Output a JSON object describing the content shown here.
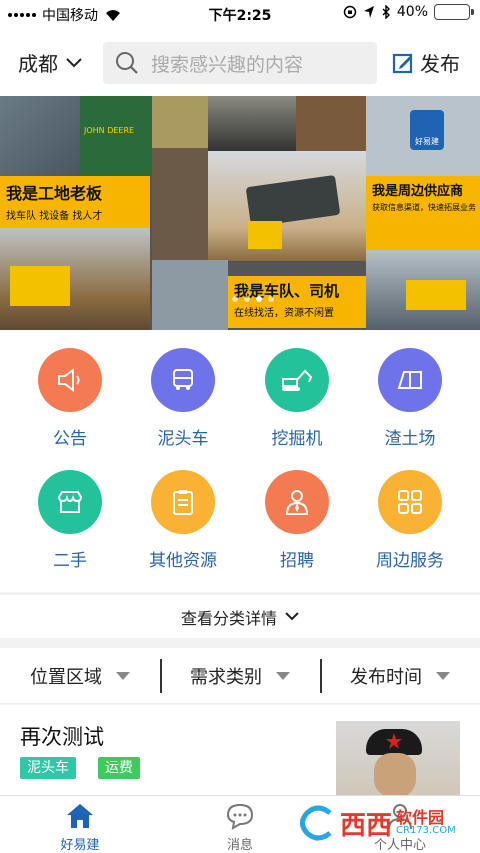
{
  "status_bar": {
    "carrier": "中国移动",
    "time": "下午2:25",
    "battery": "40%",
    "battery_level": 0.4
  },
  "header": {
    "city": "成都",
    "search_placeholder": "搜索感兴趣的内容",
    "publish_label": "发布"
  },
  "banner": {
    "cards": [
      {
        "title": "我是工地老板",
        "subtitle": "找车队  找设备  找人才"
      },
      {
        "title": "我是周边供应商",
        "subtitle": "获取信息渠道，快速拓展业务"
      },
      {
        "title": "我是车队、司机",
        "subtitle": "在线找活，资源不闲置"
      }
    ],
    "brand_text": "JOHN DEERE",
    "logo_text": "好易建",
    "slide_count": 4,
    "active_slide": 2
  },
  "categories": [
    {
      "label": "公告",
      "icon": "megaphone-icon",
      "color": "#f47a52"
    },
    {
      "label": "泥头车",
      "icon": "truck-icon",
      "color": "#6f73ea"
    },
    {
      "label": "挖掘机",
      "icon": "excavator-icon",
      "color": "#24c29a"
    },
    {
      "label": "渣土场",
      "icon": "land-icon",
      "color": "#6f73ea"
    },
    {
      "label": "二手",
      "icon": "shop-icon",
      "color": "#24c29a"
    },
    {
      "label": "其他资源",
      "icon": "clipboard-icon",
      "color": "#f9b233"
    },
    {
      "label": "招聘",
      "icon": "person-icon",
      "color": "#f47a52"
    },
    {
      "label": "周边服务",
      "icon": "grid-icon",
      "color": "#f9b233"
    }
  ],
  "more_label": "查看分类详情",
  "filters": [
    {
      "label": "位置区域"
    },
    {
      "label": "需求类别"
    },
    {
      "label": "发布时间"
    }
  ],
  "listing": {
    "title": "再次测试",
    "tags": [
      {
        "label": "泥头车",
        "color": "#2fc7a6"
      },
      {
        "label": "运费",
        "color": "#3fca5e"
      }
    ]
  },
  "tabbar": {
    "tabs": [
      {
        "label": "好易建",
        "icon": "home-icon",
        "active": true
      },
      {
        "label": "消息",
        "icon": "chat-icon",
        "active": false
      },
      {
        "label": "个人中心",
        "icon": "user-icon",
        "active": false
      }
    ],
    "active_color": "#1f64b4"
  },
  "watermark": {
    "brand": "西西",
    "suffix": "软件园",
    "domain": "CR173.COM"
  }
}
